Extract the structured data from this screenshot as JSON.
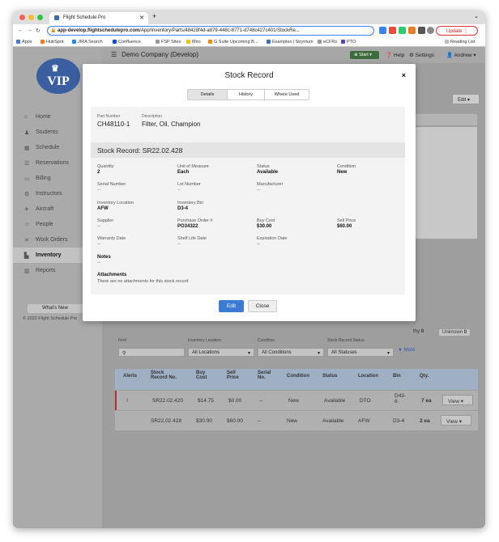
{
  "browser": {
    "tab_title": "Flight Schedule Pro",
    "url_host": "app-develop.flightschedulepro.com",
    "url_path": "/App/Inventory/Parts/48428f4d-a879-448c-8771-d748c427c401/StockRe...",
    "update_label": "Update",
    "bookmarks": [
      "Apps",
      "HubSpot",
      "JIRA Search",
      "Confluence",
      "FSP Sites",
      "Miro",
      "G Suite Upcoming B...",
      "Examples | Stryntum",
      "eCFRs",
      "PTO",
      "Reading List"
    ]
  },
  "colors": {
    "accent": "#3b7bd4",
    "alert": "#c0392b",
    "start": "#3c6b3c"
  },
  "topbar": {
    "company": "Demo Company (Develop)",
    "start": "Start",
    "help": "Help",
    "settings": "Settings",
    "user": "Andrew"
  },
  "sidebar": {
    "logo": "VIP",
    "items": [
      {
        "label": "Home",
        "icon": "home-icon"
      },
      {
        "label": "Students",
        "icon": "students-icon"
      },
      {
        "label": "Schedule",
        "icon": "calendar-icon"
      },
      {
        "label": "Reservations",
        "icon": "list-icon"
      },
      {
        "label": "Billing",
        "icon": "billing-icon"
      },
      {
        "label": "Instructors",
        "icon": "instructors-icon"
      },
      {
        "label": "Aircraft",
        "icon": "plane-icon"
      },
      {
        "label": "People",
        "icon": "people-icon"
      },
      {
        "label": "Work Orders",
        "icon": "wrench-icon"
      },
      {
        "label": "Inventory",
        "icon": "inventory-icon"
      },
      {
        "label": "Reports",
        "icon": "chart-icon"
      }
    ],
    "whats_new": "What's New",
    "copyright": "© 2022 Flight Schedule Pro"
  },
  "background": {
    "edit": "Edit",
    "status_counts": [
      {
        "label": "thy",
        "count": "0"
      },
      {
        "label": "Unknown",
        "count": "0"
      }
    ],
    "filters": {
      "find_label": "Find",
      "location_label": "Inventory Location",
      "condition_label": "Condition",
      "status_label": "Stock Record Status",
      "location_value": "All Locations",
      "condition_value": "All Conditions",
      "status_value": "All Statuses",
      "more": "More"
    },
    "columns": [
      "Alerts",
      "Stock Record No.",
      "Buy Cost",
      "Sell Price",
      "Serial No.",
      "Condition",
      "Status",
      "Location",
      "Bin",
      "Qty."
    ],
    "rows": [
      {
        "alert": "!",
        "record": "SR22.02.420",
        "buy": "$14.75",
        "sell": "$0.00",
        "serial": "--",
        "condition": "New",
        "status": "Available",
        "location": "DTO",
        "bin": "D43-6",
        "qty": "7 ea",
        "action": "View"
      },
      {
        "alert": "",
        "record": "SR22.02.428",
        "buy": "$30.00",
        "sell": "$60.00",
        "serial": "--",
        "condition": "New",
        "status": "Available",
        "location": "AFW",
        "bin": "D3-4",
        "qty": "2 ea",
        "action": "View"
      }
    ]
  },
  "modal": {
    "title": "Stock Record",
    "close": "×",
    "tabs": [
      "Details",
      "History",
      "Where Used"
    ],
    "part_number_label": "Part Number",
    "part_number": "CH48110-1",
    "description_label": "Description",
    "description": "Filter, Oil, Champion",
    "record_heading": "Stock Record: SR22.02.428",
    "fields": {
      "quantity": {
        "label": "Quantity",
        "value": "2"
      },
      "uom": {
        "label": "Unit of Measure",
        "value": "Each"
      },
      "status": {
        "label": "Status",
        "value": "Available"
      },
      "condition": {
        "label": "Condition",
        "value": "New"
      },
      "serial": {
        "label": "Serial Number",
        "value": "--"
      },
      "lot": {
        "label": "Lot Number",
        "value": "--"
      },
      "manufacturer": {
        "label": "Manufacturer",
        "value": "--"
      },
      "location": {
        "label": "Inventory Location",
        "value": "AFW"
      },
      "bin": {
        "label": "Inventory Bin",
        "value": "D3-4"
      },
      "supplier": {
        "label": "Supplier",
        "value": "--"
      },
      "po": {
        "label": "Purchase Order #",
        "value": "PO34322"
      },
      "buy": {
        "label": "Buy Cost",
        "value": "$30.00"
      },
      "sell": {
        "label": "Sell Price",
        "value": "$60.00"
      },
      "warranty": {
        "label": "Warranty Date",
        "value": "--"
      },
      "shelf": {
        "label": "Shelf Life Date",
        "value": "--"
      },
      "expiration": {
        "label": "Expiration Date",
        "value": "--"
      }
    },
    "notes_label": "Notes",
    "notes_value": "--",
    "attachments_label": "Attachments",
    "attachments_value": "There are no attachments for this stock record",
    "edit_button": "Edit",
    "close_button": "Close"
  }
}
